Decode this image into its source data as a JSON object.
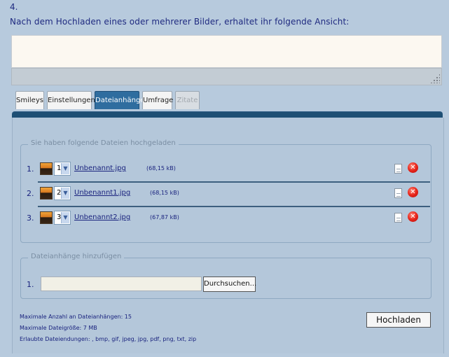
{
  "step_number": "4.",
  "intro_text": "Nach dem Hochladen eines oder mehrerer Bilder, erhaltet ihr folgende Ansicht:",
  "tabs": [
    {
      "label": "Smileys"
    },
    {
      "label": "Einstellungen"
    },
    {
      "label": "Dateianhänge"
    },
    {
      "label": "Umfrage"
    },
    {
      "label": "Zitate"
    }
  ],
  "active_tab": "Dateianhänge",
  "uploaded_section": {
    "legend": "Sie haben folgende Dateien hochgeladen",
    "files": [
      {
        "num": "1.",
        "order": "1",
        "name": "Unbenannt.jpg",
        "size": "(68,15 kB)"
      },
      {
        "num": "2.",
        "order": "2",
        "name": "Unbenannt1.jpg",
        "size": "(68,15 kB)"
      },
      {
        "num": "3.",
        "order": "3",
        "name": "Unbenannt2.jpg",
        "size": "(67,87 kB)"
      }
    ]
  },
  "add_section": {
    "legend": "Dateianhänge hinzufügen",
    "row_num": "1.",
    "file_value": "",
    "browse_label": "Durchsuchen..."
  },
  "info": {
    "max_count": "Maximale Anzahl an Dateianhängen: 15",
    "max_size": "Maximale Dateigröße: 7 MB",
    "extensions": "Erlaubte Dateiendungen: , bmp, gif, jpeg, jpg, pdf, png, txt, zip"
  },
  "upload_label": "Hochladen",
  "colors": {
    "background": "#b7cadd",
    "text": "#1a237e",
    "active_tab": "#2f6d9f",
    "panel_header": "#1e4f74",
    "delete": "#e8251a"
  },
  "icons": {
    "thumbnail": "image-thumbnail-icon",
    "insert": "document-icon",
    "delete": "delete-icon",
    "resize": "resize-grip-icon"
  }
}
